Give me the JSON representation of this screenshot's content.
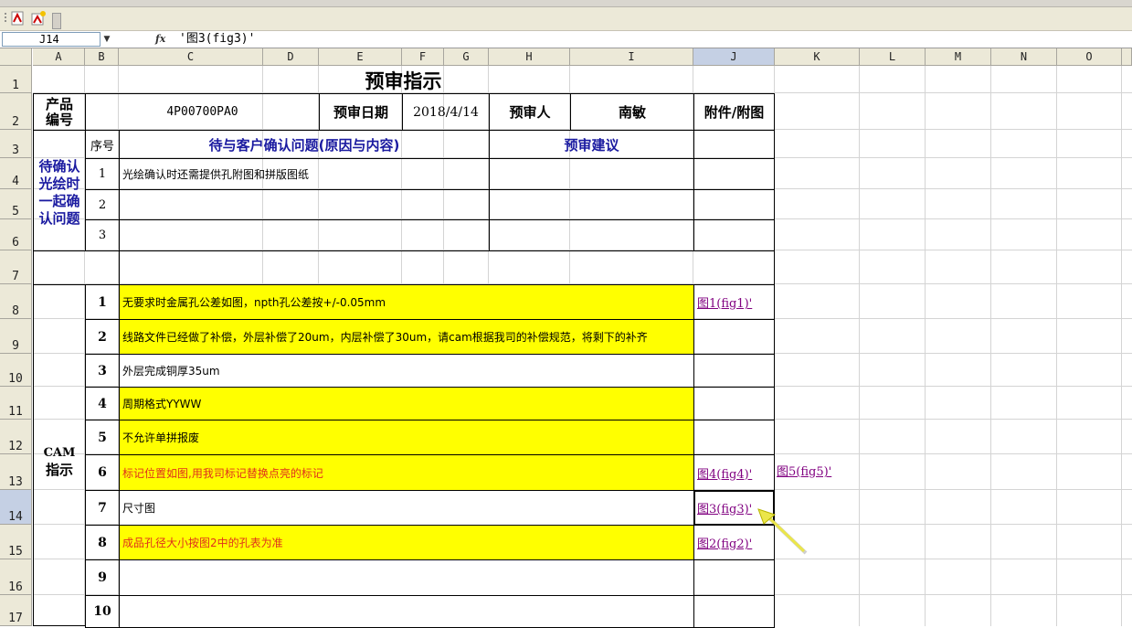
{
  "formula_bar": {
    "name_box": "J14",
    "fx": "fx",
    "content": "'图3(fig3)'"
  },
  "columns": [
    "A",
    "B",
    "C",
    "D",
    "E",
    "F",
    "G",
    "H",
    "I",
    "J",
    "K",
    "L",
    "M",
    "N",
    "O"
  ],
  "rows": [
    "1",
    "2",
    "3",
    "4",
    "5",
    "6",
    "7",
    "8",
    "9",
    "10",
    "11",
    "12",
    "13",
    "14",
    "15",
    "16",
    "17"
  ],
  "sheet": {
    "title": "预审指示",
    "product_no_label": "产品\n编号",
    "product_no": "4P00700PA0",
    "review_date_label": "预审日期",
    "review_date": "2018/4/14",
    "reviewer_label": "预审人",
    "reviewer": "南敏",
    "attachment_label": "附件/附图",
    "seq_label": "序号",
    "confirm_header": "待与客户确认问题(原因与内容)",
    "suggestion_header": "预审建议",
    "pending_label": "待确认光绘时一起确认问题",
    "pending_items": [
      {
        "no": "1",
        "text": "光绘确认时还需提供孔附图和拼版图纸"
      },
      {
        "no": "2",
        "text": ""
      },
      {
        "no": "3",
        "text": ""
      }
    ],
    "cam_label_1": "CAM",
    "cam_label_2": "指示",
    "cam_items": [
      {
        "no": "1",
        "text": "无要求时金属孔公差如图，npth孔公差按+/-0.05mm",
        "link": "图1(fig1)'"
      },
      {
        "no": "2",
        "text": "线路文件已经做了补偿，外层补偿了20um，内层补偿了30um，请cam根据我司的补偿规范，将剩下的补齐",
        "link": ""
      },
      {
        "no": "3",
        "text": "外层完成铜厚35um",
        "link": ""
      },
      {
        "no": "4",
        "text": "周期格式YYWW",
        "link": ""
      },
      {
        "no": "5",
        "text": "不允许单拼报废",
        "link": ""
      },
      {
        "no": "6",
        "text": "标记位置如图,用我司标记替换点亮的标记",
        "link": "图4(fig4)'",
        "link2": "图5(fig5)'"
      },
      {
        "no": "7",
        "text": "尺寸图",
        "link": "图3(fig3)'"
      },
      {
        "no": "8",
        "text": "成品孔径大小按图2中的孔表为准",
        "link": "图2(fig2)'"
      },
      {
        "no": "9",
        "text": "",
        "link": ""
      },
      {
        "no": "10",
        "text": "",
        "link": ""
      }
    ]
  },
  "colors": {
    "highlight": "#ffff00",
    "heading_blue": "#1a1aa0",
    "red_text": "#e0301c",
    "link": "#800080",
    "selection": "#c5d0e4"
  }
}
